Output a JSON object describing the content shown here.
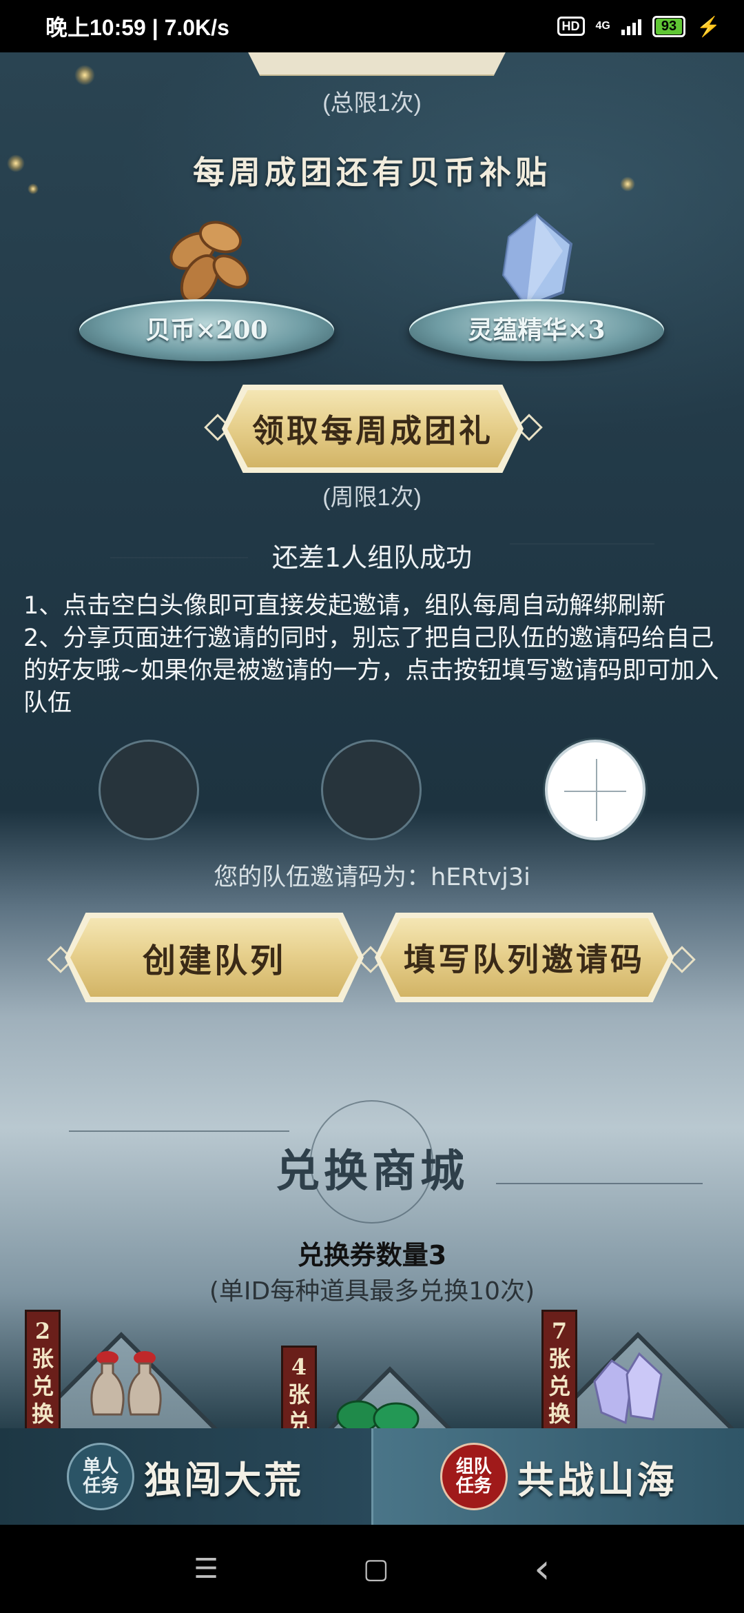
{
  "status_bar": {
    "time_speed": "晚上10:59 | 7.0K/s",
    "hd": "HD",
    "network": "4G",
    "battery": "93",
    "charging": "⚡"
  },
  "weekly": {
    "total_limit": "(总限1次)",
    "title": "每周成团还有贝币补贴",
    "rewards": [
      {
        "label": "贝币×200",
        "icon": "cowrie-shell-icon"
      },
      {
        "label": "灵蕴精华×3",
        "icon": "crystal-icon"
      }
    ],
    "claim_button": "领取每周成团礼",
    "weekly_limit": "(周限1次)"
  },
  "team": {
    "status": "还差1人组队成功",
    "rules": [
      "1、点击空白头像即可直接发起邀请，组队每周自动解绑刷新",
      "2、分享页面进行邀请的同时，别忘了把自己队伍的邀请码给自己的好友哦~如果你是被邀请的一方，点击按钮填写邀请码即可加入队伍"
    ],
    "invite_code_label": "您的队伍邀请码为：hERtvj3i",
    "create_button": "创建队列",
    "fill_code_button": "填写队列邀请码"
  },
  "shop": {
    "title": "兑换商城",
    "voucher_count": "兑换券数量3",
    "note": "(单ID每种道具最多兑换10次)",
    "items": [
      {
        "tag": "2\n张\n兑\n换",
        "icon": "vase-icon"
      },
      {
        "tag": "4\n张\n兑",
        "icon": "jade-icon"
      },
      {
        "tag": "7\n张\n兑\n换",
        "icon": "crystal-icon"
      }
    ]
  },
  "tabs": {
    "solo_seal": "单人\n任务",
    "solo_label": "独闯大荒",
    "team_seal": "组队\n任务",
    "team_label": "共战山海"
  },
  "nav": {
    "menu_icon": "☰",
    "home_icon": "▢",
    "back_icon": "‹"
  }
}
